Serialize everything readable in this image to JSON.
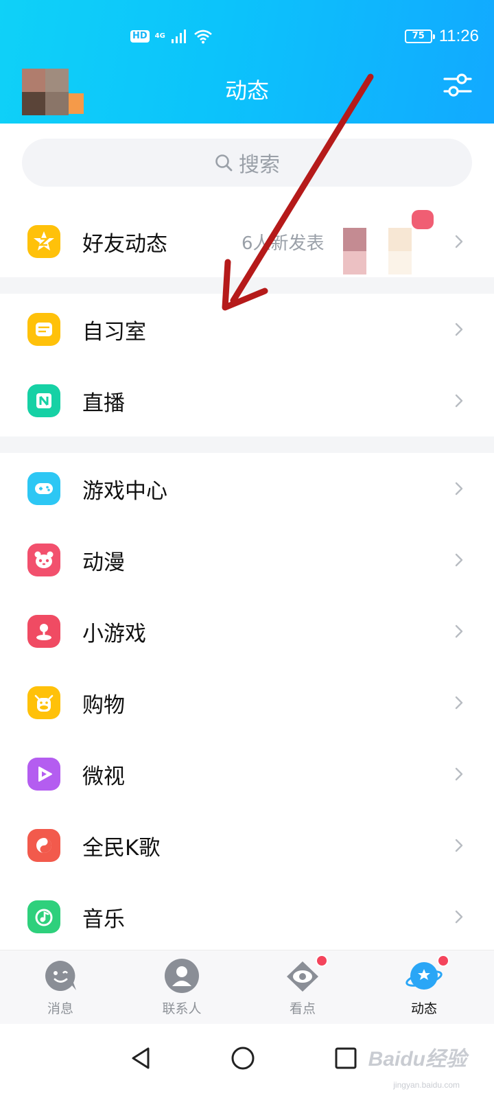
{
  "status_bar": {
    "hd": "HD",
    "network": "4G",
    "battery": "75",
    "time": "11:26"
  },
  "header": {
    "title": "动态"
  },
  "search": {
    "placeholder": "搜索"
  },
  "friends_feed": {
    "label": "好友动态",
    "subtitle": "6人新发表"
  },
  "group1": [
    {
      "label": "自习室",
      "icon": "study-room-icon",
      "color": "#ffc10a"
    },
    {
      "label": "直播",
      "icon": "live-icon",
      "color": "#16d1a5"
    }
  ],
  "group2": [
    {
      "label": "游戏中心",
      "icon": "gamepad-icon",
      "color": "#2dc7f4"
    },
    {
      "label": "动漫",
      "icon": "panda-icon",
      "color": "#f2506d"
    },
    {
      "label": "小游戏",
      "icon": "joystick-icon",
      "color": "#f04b63"
    },
    {
      "label": "购物",
      "icon": "cow-icon",
      "color": "#ffc10a"
    },
    {
      "label": "微视",
      "icon": "play-icon",
      "color": "#b45df0"
    },
    {
      "label": "全民K歌",
      "icon": "karaoke-icon",
      "color": "#f25a4c"
    },
    {
      "label": "音乐",
      "icon": "music-icon",
      "color": "#2ed07c"
    }
  ],
  "tabs": {
    "messages": "消息",
    "contacts": "联系人",
    "watch": "看点",
    "moments": "动态"
  },
  "watermark": {
    "brand": "Baidu经验",
    "url": "jingyan.baidu.com"
  },
  "colors": {
    "header_gradient_start": "#0fd1f8",
    "header_gradient_end": "#12a9ff",
    "annotation_arrow": "#b51a1a",
    "badge_dot": "#f4445c"
  }
}
